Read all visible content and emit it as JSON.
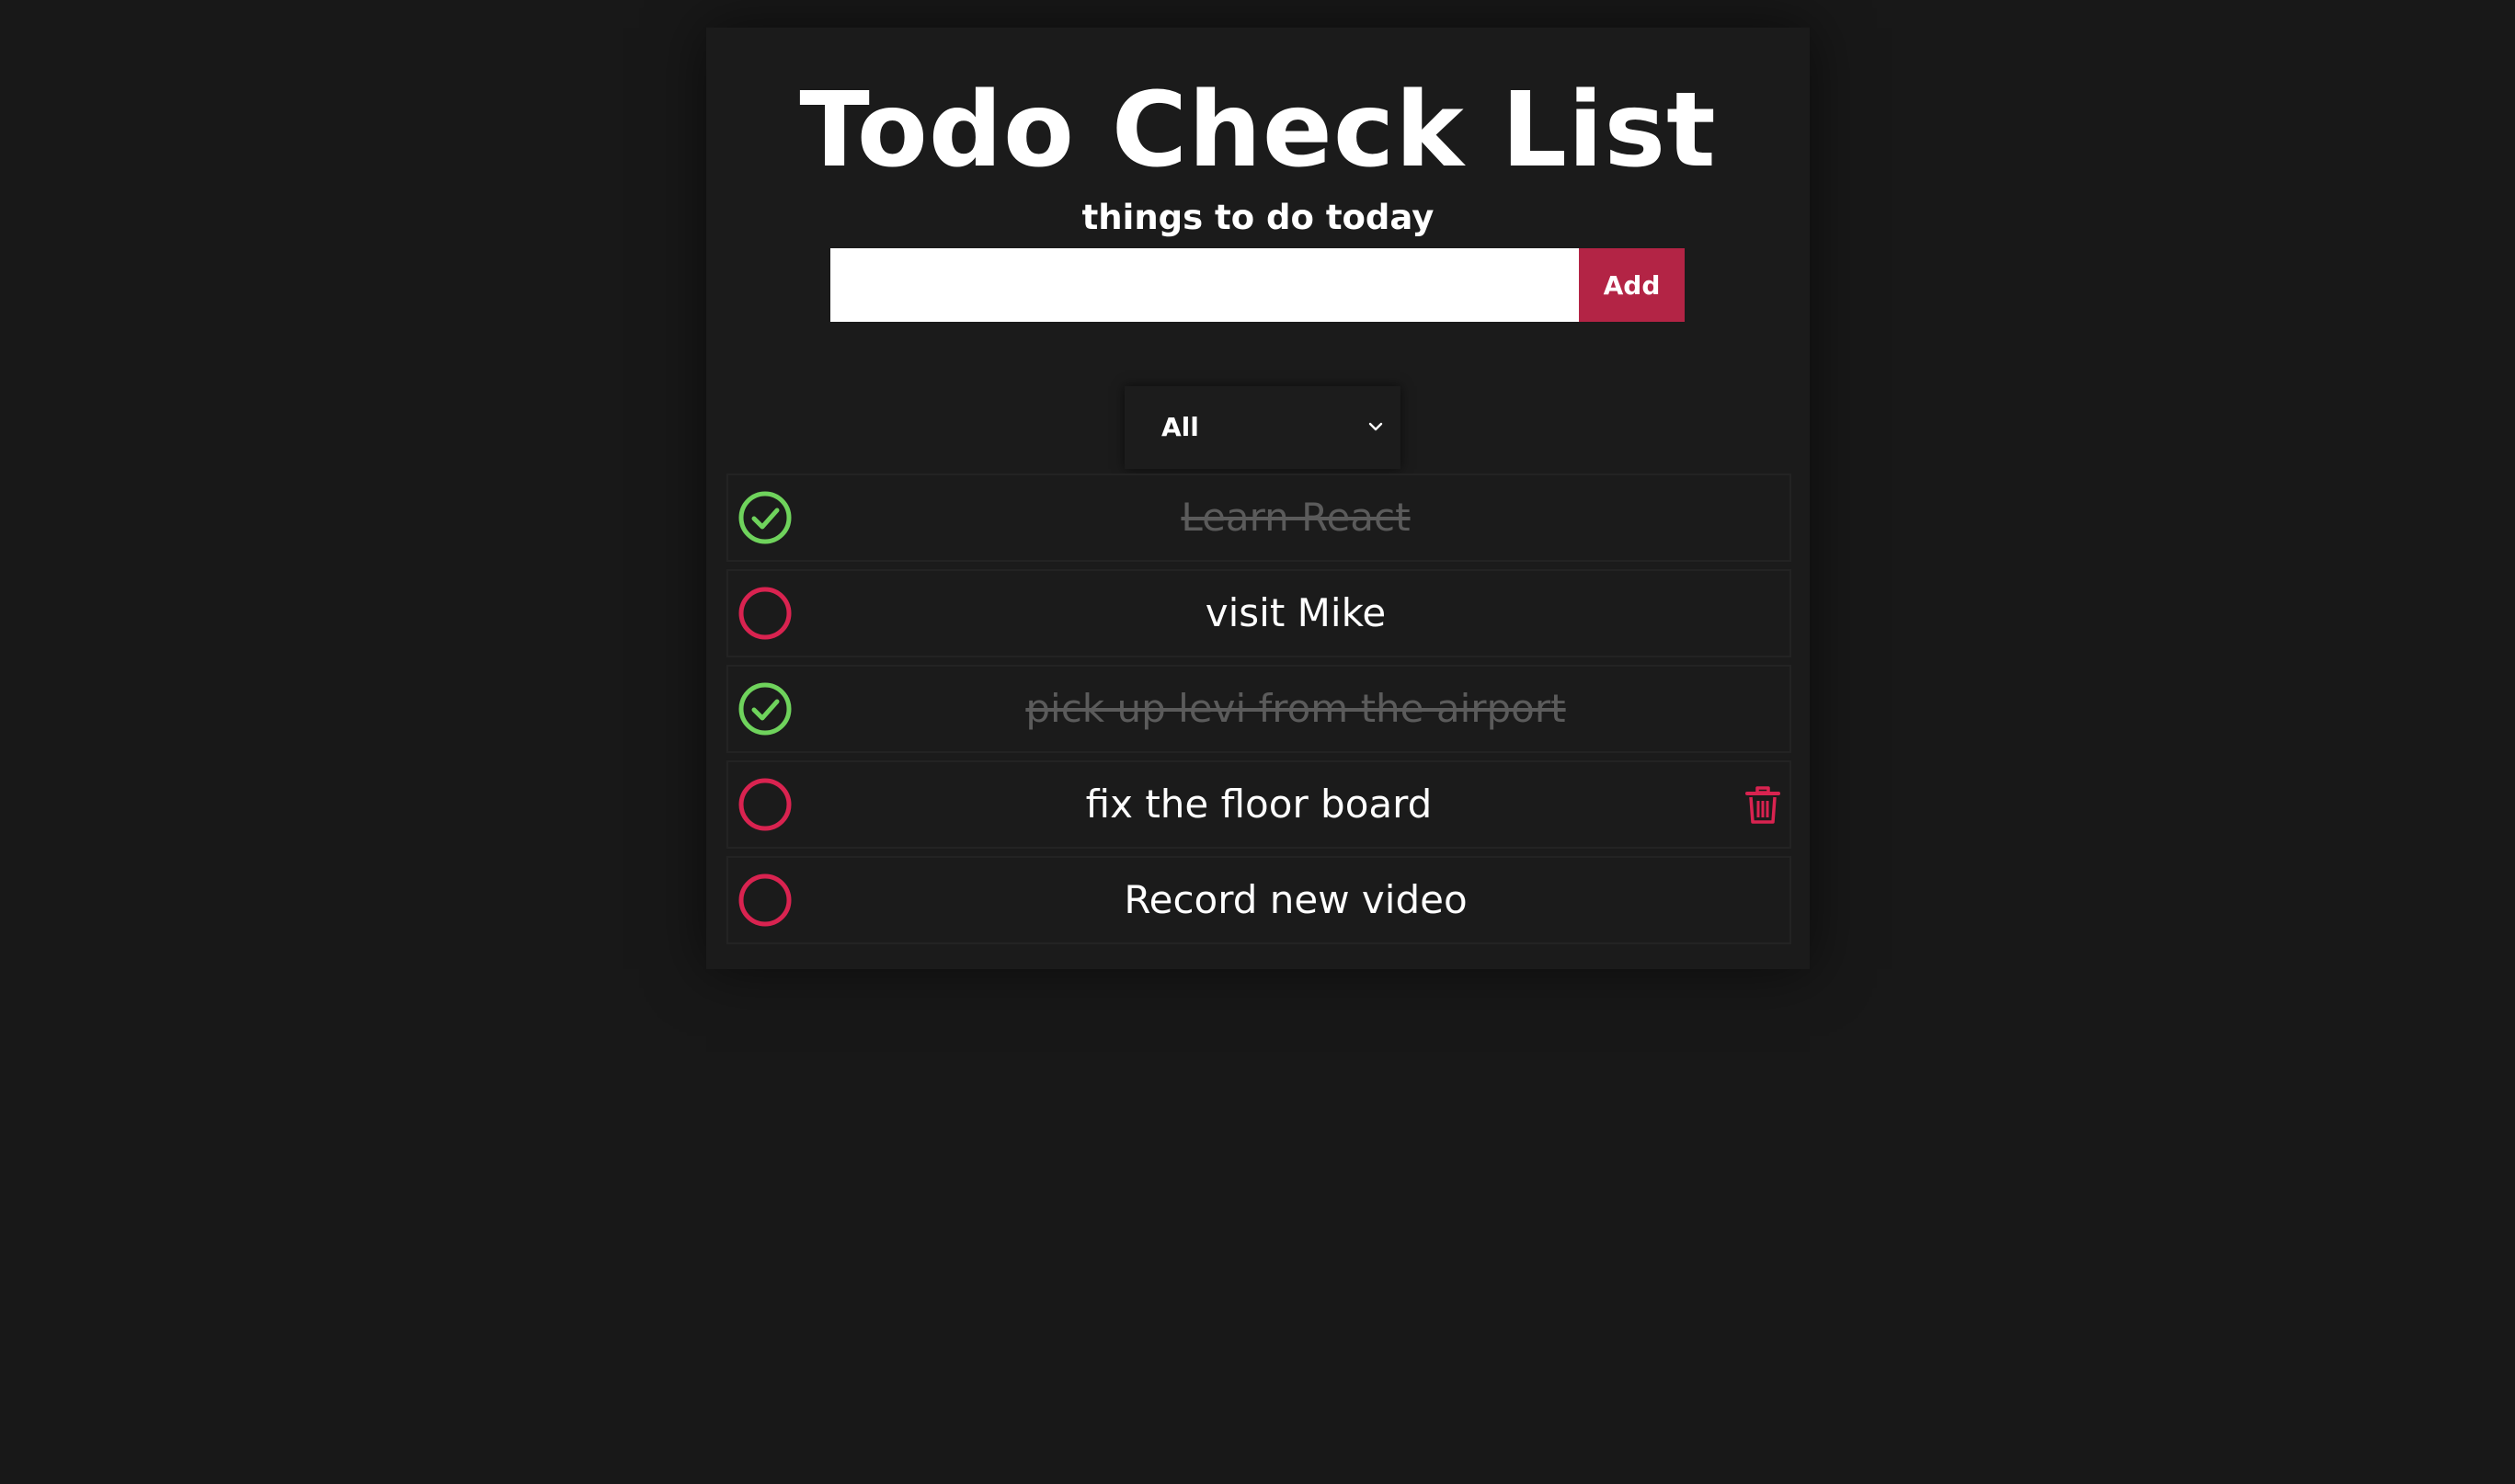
{
  "header": {
    "title": "Todo Check List",
    "subtitle": "things to do today"
  },
  "add_form": {
    "input_value": "",
    "input_placeholder": "",
    "button_label": "Add"
  },
  "filter": {
    "selected": "All",
    "icon": "chevron-down-icon"
  },
  "todos": [
    {
      "text": "Learn React",
      "completed": true,
      "status_icon": "check-circle-icon"
    },
    {
      "text": "visit Mike",
      "completed": false,
      "status_icon": "empty-circle-icon"
    },
    {
      "text": "pick up levi from the airport",
      "completed": true,
      "status_icon": "check-circle-icon"
    },
    {
      "text": "fix the floor board",
      "completed": false,
      "status_icon": "empty-circle-icon",
      "delete_icon": "trash-icon"
    },
    {
      "text": "Record new video",
      "completed": false,
      "status_icon": "empty-circle-icon"
    }
  ],
  "colors": {
    "background": "#181818",
    "accent": "#b32445",
    "completed_green": "#6fd35c",
    "pending_red": "#d92350",
    "done_text": "#5b5b5b"
  }
}
